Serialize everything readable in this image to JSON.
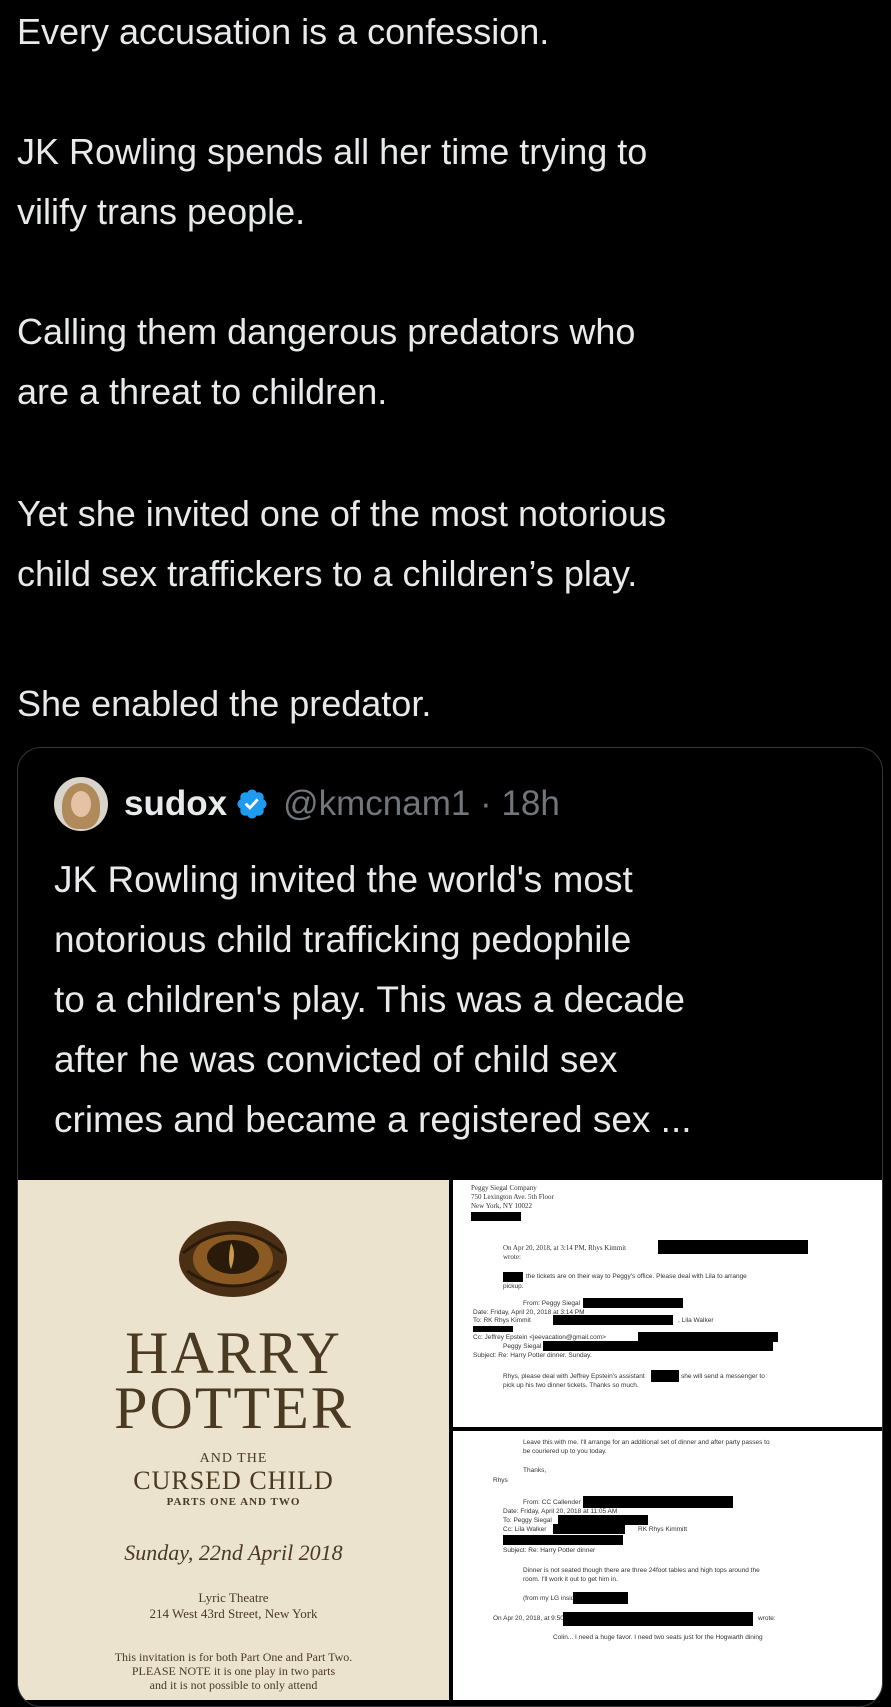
{
  "post": {
    "lines": [
      "Every accusation is a confession.",
      "JK Rowling spends all her time trying to",
      "vilify trans people.",
      "Calling them dangerous predators who",
      "are a threat to children.",
      "Yet she invited one of the most notorious",
      "child sex traffickers to a children’s play.",
      "She enabled the predator."
    ]
  },
  "quote": {
    "name": "sudox",
    "handle": "@kmcnam1 · 18h",
    "verified_icon": "verified-badge-icon",
    "lines": [
      "JK Rowling invited the world's most",
      "notorious child trafficking pedophile",
      "to a children's play. This was a decade",
      "after he was convicted of child sex",
      "crimes and became a registered sex ..."
    ]
  },
  "invitation": {
    "harry": "HARRY",
    "potter": "POTTER",
    "and_the": "AND THE",
    "cursed": "CURSED CHILD",
    "parts": "PARTS ONE AND TWO",
    "date": "Sunday, 22nd April 2018",
    "theatre": "Lyric Theatre",
    "address": "214 West 43rd Street, New York",
    "note1": "This invitation is for both Part One and Part Two.",
    "note2": "PLEASE NOTE it is one play in two parts",
    "note3": "and it is not possible to only attend"
  },
  "email1": {
    "company": "Peggy Siegal Company",
    "address1": "750 Lexington Ave. 5th Floor",
    "address2": "New York, NY 10022",
    "on_line": "On Apr 20, 2018, at 3:14 PM, Rhys Kimmit",
    "wrote": "wrote:",
    "tickets": "the tickets are on their way to Peggy's office. Please deal with Lila to arrange",
    "pickup": "pickup.",
    "from": "From: Peggy Siegal",
    "date": "Date: Friday, April 20, 2018 at 3:14 PM",
    "to": "To: RK Rhys Kimmit",
    "lila": ", Lila Walker",
    "cc": "Cc: Jeffrey Epstein <jeevacation@gmail.com>",
    "peggy": "Peggy Siegal",
    "subject": "Subject: Re: Harry Potter dinner. Sunday.",
    "body1": "Rhys, please deal with Jeffrey Epstein's assistant",
    "body1b": "she will send a messenger to",
    "body2": "pick up his two dinner tickets.  Thanks so much."
  },
  "email2": {
    "leave": "Leave this with me. I'll arrange for an additional set of dinner and after party passes to",
    "leave2": "be couriered up to you today.",
    "thanks": "Thanks,",
    "rhys": "Rhys",
    "from": "From: CC Callender",
    "date": "Date: Friday, April 20, 2018 at 11:05 AM",
    "to": "To: Peggy Siegal",
    "cc": "Cc: Lila Walker",
    "rk": "RK Rhys Kimmitt",
    "subject": "Subject: Re: Harry Potter dinner",
    "dinner": "Dinner is not seated though there are three 24foot tables and high tops around the",
    "dinner2": "room. I'll work it out to get him in.",
    "sent": "(from my LG inside)",
    "on_line": "On Apr 20, 2018, at 9:50 AM,",
    "wrote": "wrote:",
    "colin": "Colin... I need a huge favor. I need two seats just for the Hogwarth dining"
  }
}
